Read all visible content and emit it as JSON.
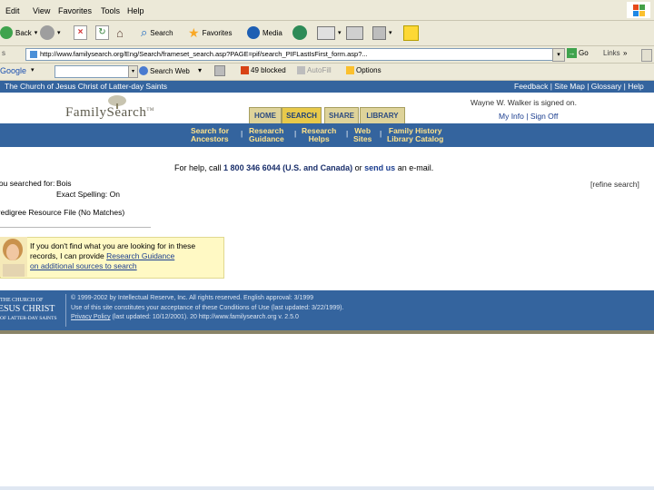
{
  "menu": [
    "Edit",
    "View",
    "Favorites",
    "Tools",
    "Help"
  ],
  "toolbar": {
    "back": "Back",
    "search": "Search",
    "favorites": "Favorites",
    "media": "Media"
  },
  "address": {
    "url": "http://www.familysearch.org/Eng/Search/frameset_search.asp?PAGE=pif/search_PIFLastIsFirst_form.asp?...",
    "go": "Go",
    "links": "Links"
  },
  "googlebar": {
    "logo": "Google",
    "search_web": "Search Web",
    "blocked": "49 blocked",
    "autofill": "AutoFill",
    "options": "Options"
  },
  "churchbar": {
    "title": "The Church of Jesus Christ of Latter-day Saints",
    "links": [
      "Feedback",
      "Site Map",
      "Glossary",
      "Help"
    ]
  },
  "header": {
    "logo": "FamilySearch",
    "tm": "TM",
    "tabs": [
      "HOME",
      "SEARCH",
      "SHARE",
      "LIBRARY"
    ],
    "signed_on": "Wayne W. Walker is signed on.",
    "myinfo": "My Info",
    "signoff": "Sign Off"
  },
  "subnav": [
    [
      "Search for",
      "Ancestors"
    ],
    [
      "Research",
      "Guidance"
    ],
    [
      "Research",
      "Helps"
    ],
    [
      "Web",
      "Sites"
    ],
    [
      "Family History",
      "Library Catalog"
    ]
  ],
  "help": {
    "prefix": "For help, call",
    "phone": "1 800 346 6044 (U.S. and Canada)",
    "mid": "or",
    "link": "send us",
    "suffix": "an e-mail."
  },
  "search": {
    "label": "You searched for:",
    "name": "Bois",
    "exact": "Exact Spelling: On",
    "refine": "[refine search]",
    "result": "Pedigree Resource File (No Matches)"
  },
  "guidance": {
    "line1": "If you don't find what you are looking for in these",
    "line2_prefix": "records, I can provide",
    "line2_link": "Research Guidance",
    "line3": "on additional sources to search"
  },
  "footer": {
    "church_line1": "THE CHURCH OF",
    "church_line2": "JESUS CHRIST",
    "church_line3": "OF LATTER-DAY SAINTS",
    "copyright": "© 1999-2002 by Intellectual Reserve, Inc. All rights reserved. English approval: 3/1999",
    "terms": "Use of this site constitutes your acceptance of these Conditions of Use (last updated: 3/22/1999).",
    "privacy": "Privacy Policy",
    "privacy_rest": "(last updated: 10/12/2001). 20 http://www.familysearch.org v. 2.5.0"
  },
  "colors": {
    "blue_band": "#34649e",
    "tab_active": "#e8c94a",
    "nav_text": "#ffe28a"
  }
}
